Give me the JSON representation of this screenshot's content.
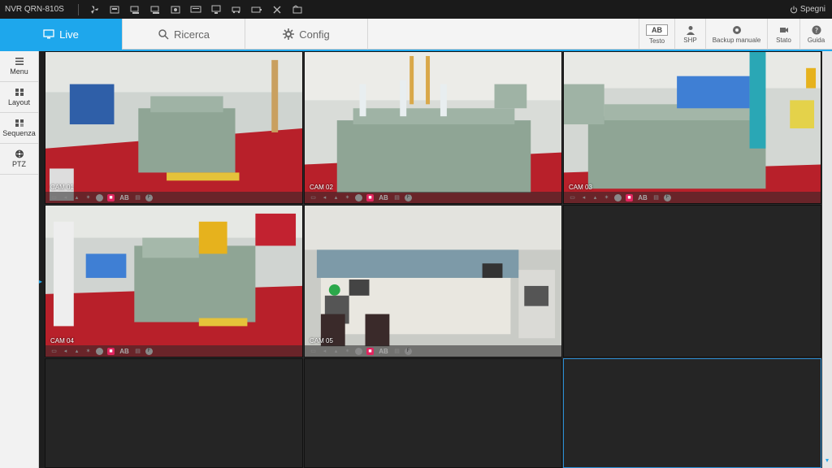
{
  "app": {
    "title": "NVR QRN-810S",
    "power_label": "Spegni"
  },
  "toolbar_icons": [
    "fan-icon",
    "hdd-icon",
    "network-full-icon",
    "network-pro-icon",
    "record-icon",
    "text-input-icon",
    "monitor-icon",
    "car-icon",
    "battery-icon",
    "fan-alt-icon",
    "folder-icon"
  ],
  "tabs": [
    {
      "label": "Live",
      "icon": "monitor-icon",
      "active": true
    },
    {
      "label": "Ricerca",
      "icon": "search-icon",
      "active": false
    },
    {
      "label": "Config",
      "icon": "gear-icon",
      "active": false
    }
  ],
  "tools": [
    {
      "label": "Testo",
      "icon": "text-ab-icon",
      "badge": "AB"
    },
    {
      "label": "SHP",
      "icon": "person-icon"
    },
    {
      "label": "Backup manuale",
      "icon": "backup-icon"
    },
    {
      "label": "Stato",
      "icon": "status-icon"
    },
    {
      "label": "Guida",
      "icon": "help-icon"
    }
  ],
  "sidebar": [
    {
      "label": "Menu",
      "icon": "hamburger-icon"
    },
    {
      "label": "Layout",
      "icon": "layout-icon"
    },
    {
      "label": "Sequenza",
      "icon": "sequence-icon"
    },
    {
      "label": "PTZ",
      "icon": "ptz-icon"
    }
  ],
  "cameras": [
    {
      "label": "CAM 01",
      "scene": "transformer"
    },
    {
      "label": "CAM 02",
      "scene": "transformer"
    },
    {
      "label": "CAM 03",
      "scene": "transformer"
    },
    {
      "label": "CAM 04",
      "scene": "transformer"
    },
    {
      "label": "CAM 05",
      "scene": "control-room"
    },
    {
      "label": "",
      "scene": "empty"
    },
    {
      "label": "",
      "scene": "empty"
    },
    {
      "label": "",
      "scene": "empty"
    },
    {
      "label": "",
      "scene": "empty",
      "selected": true
    }
  ],
  "status_badge": "AB",
  "colors": {
    "accent": "#1ea7ec",
    "record": "#e0245e",
    "floor": "#b8202a",
    "transformer": "#8fa595"
  }
}
